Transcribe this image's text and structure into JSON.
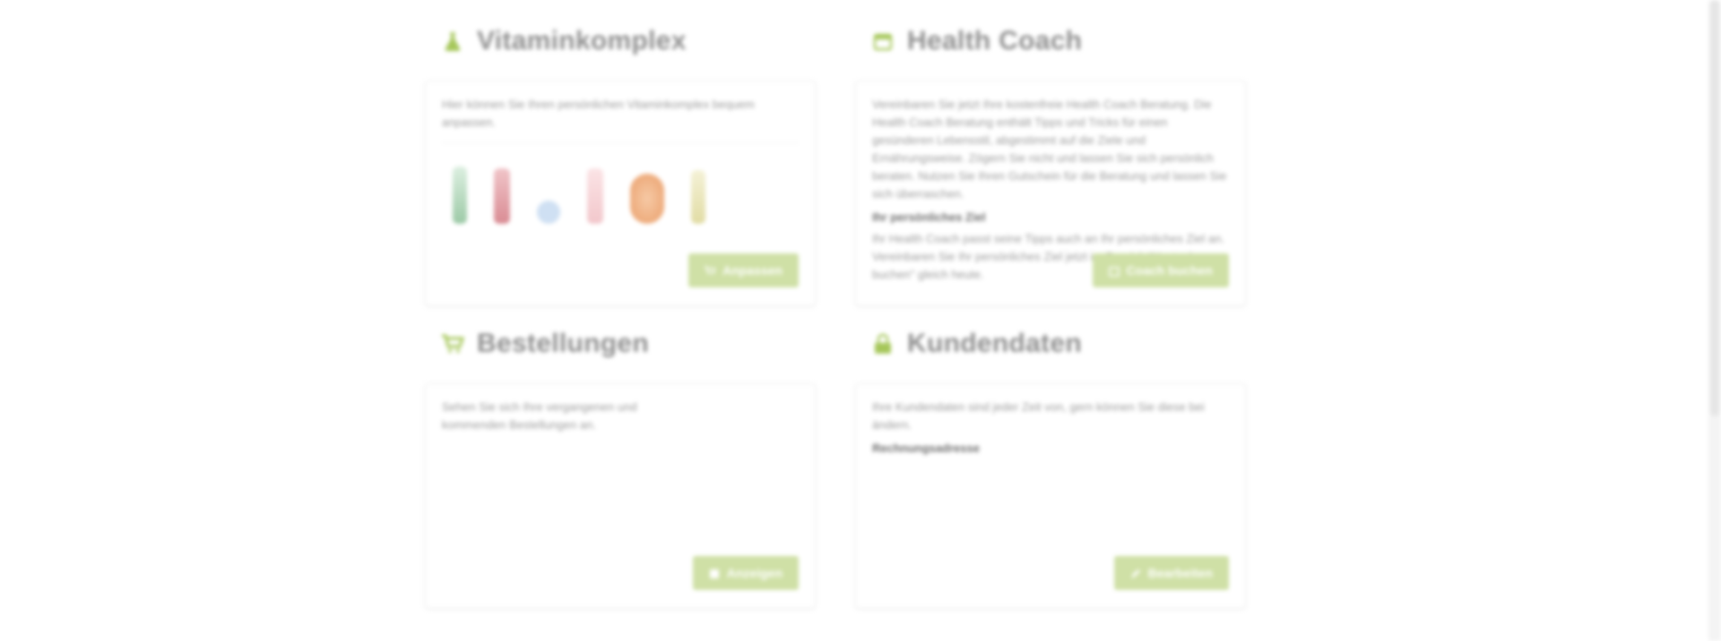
{
  "colors": {
    "accent": "#a6c75a",
    "button": "#cfe0a6",
    "title": "#8f8f8f"
  },
  "sections": {
    "vitamin": {
      "title": "Vitaminkomplex",
      "icon": "flask-icon",
      "text": "Hier können Sie Ihren persönlichen Vitaminkomplex bequem anpassen.",
      "button_label": "Anpassen",
      "button_icon": "cart-icon"
    },
    "coach": {
      "title": "Health Coach",
      "icon": "calendar-icon",
      "text": "Vereinbaren Sie jetzt Ihre kostenfreie Health Coach Beratung. Die Health Coach Beratung enthält Tipps und Tricks für einen gesünderen Lebensstil, abgestimmt auf die Ziele und Ernährungsweise. Zögern Sie nicht und lassen Sie sich persönlich beraten. Nutzen Sie Ihren Gutschein für die Beratung und lassen Sie sich überraschen.",
      "subheading": "Ihr persönliches Ziel",
      "text2": "Ihr Health Coach passt seine Tipps auch an Ihr persönliches Ziel an. Vereinbaren Sie Ihr persönliches Ziel jetzt im Bereich \"Kostenlos buchen\" gleich heute.",
      "button_label": "Coach buchen",
      "button_icon": "calendar-small-icon"
    },
    "orders": {
      "title": "Bestellungen",
      "icon": "cart-icon",
      "text": "Sehen Sie sich Ihre vergangenen und kommenden Bestellungen an.",
      "button_label": "Anzeigen",
      "button_icon": "list-icon"
    },
    "customer": {
      "title": "Kundendaten",
      "icon": "lock-icon",
      "text": "Ihre Kundendaten sind jeder Zeit von, gern können Sie diese bei ändern.",
      "subheading": "Rechnungsadresse",
      "button_label": "Bearbeiten",
      "button_icon": "pencil-icon"
    }
  }
}
